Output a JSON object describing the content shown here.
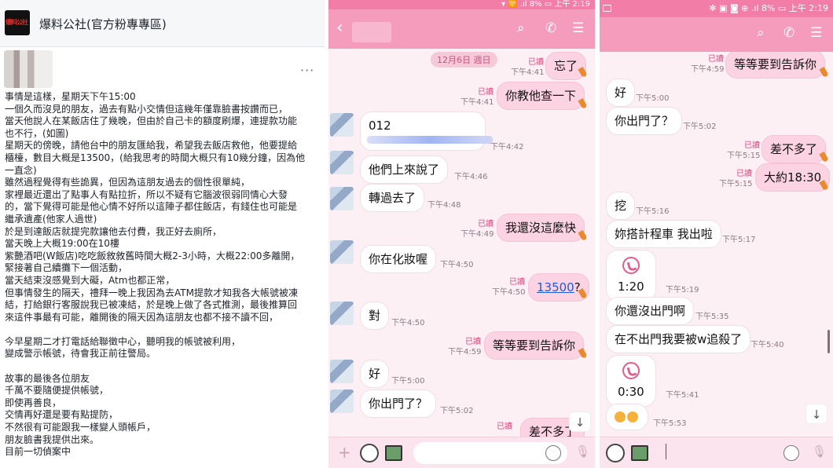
{
  "facebook": {
    "page_name": "爆料公社(官方粉專專區)",
    "logo_text": "爆料公社",
    "more": "···",
    "post_lines": [
      "事情是這樣，星期天下午15:00",
      "一個久而沒見的朋友，過去有點小交情但這幾年僅靠臉書按讚而已，",
      "當天他說人在某飯店住了幾晚，但由於自己卡的額度刷爆，連提款功能",
      "也不行，(如圖)",
      "星期天的傍晚，請他台中的朋友匯給我，希望我去飯店救他，他要提給",
      "櫃檯，數目大概是13500，(給我思考的時間大概只有10幾分鐘，因為他",
      "一直念)",
      "雖然過程覺得有些詭異，但因為這朋友過去的個性很單純，",
      "家裡最近還出了點事人有點拉折，所以不疑有它腦波很弱同情心大發",
      "的，當下覺得可能是他心情不好所以這陣子都住飯店，有錢住也可能是",
      "繼承遺產(他家人過世)",
      "於是到達飯店就提完款讓他去付費，我正好去廁所，",
      "當天晚上大概19:00在10樓",
      "紫艷酒吧(W飯店)吃吃飯敘敘舊時間大概2-3小時，大概22:00多離開，",
      "緊接著自己續攤下一個活動，",
      "當天結束沒感覺到大礙，Atm也都正常，",
      "但事情發生的隔天，禮拜一晚上我因為去ATM提款才知我各大帳號被凍",
      "結，打給銀行客服說我已被凍結，於是晚上做了各式推測，最後推算回",
      "來這件事最有可能，離開後的隔天因為這朋友也都不接不讀不回，",
      "",
      "今早星期二才打電話給聯徵中心，聽明我的帳號被利用，",
      "變成警示帳號，待會我正前往警局。",
      "",
      "故事的最後各位朋友",
      "千萬不要隨便提供帳號，",
      "即使再善良，",
      "交情再好還是要有點提防，",
      "不然很有可能跟我一樣變人頭帳戶，",
      "朋友臉書我提供出來。",
      "目前一切偵案中"
    ]
  },
  "chat1": {
    "status": "▾ 🛜 .ıl 8% ▭ 上午 2:19",
    "icons": {
      "back": "back-arrow-icon",
      "search": "search-icon",
      "call": "phone-icon",
      "menu": "menu-icon"
    },
    "date_label": "12月6日 週日",
    "messages": [
      {
        "dir": "out",
        "text": "忘了",
        "read": "已讀",
        "time": "下午4:41"
      },
      {
        "dir": "out",
        "text": "你教他查一下",
        "read": "已讀",
        "time": "下午4:41"
      },
      {
        "dir": "in",
        "text": "012",
        "time": "下午4:42"
      },
      {
        "dir": "in",
        "text": "他們上來說了",
        "time": "下午4:46"
      },
      {
        "dir": "in",
        "text": "轉過去了",
        "time": "下午4:48"
      },
      {
        "dir": "out",
        "text": "我還沒這麼快",
        "read": "已讀",
        "time": "下午4:49"
      },
      {
        "dir": "in",
        "text": "你在化妝喔",
        "time": "下午4:50"
      },
      {
        "dir": "out",
        "text": "13500",
        "suffix": "?",
        "read": "已讀",
        "time": "下午4:50"
      },
      {
        "dir": "in",
        "text": "對",
        "time": "下午4:50"
      },
      {
        "dir": "out",
        "text": "等等要到告訴你",
        "read": "已讀",
        "time": "下午4:59"
      },
      {
        "dir": "in",
        "text": "好",
        "time": "下午5:00"
      },
      {
        "dir": "in",
        "text": "你出門了？",
        "time": "下午5:02"
      },
      {
        "dir": "out",
        "text": "差不多了",
        "read": "已讀",
        "time": ""
      }
    ],
    "scroll_down": "↓"
  },
  "chat2": {
    "status": "✻ ▣ ◙ ⊕ .ıl 8% ▭ 上午 2:19",
    "icons": {
      "search": "search-icon",
      "call": "phone-icon",
      "menu": "menu-icon"
    },
    "messages": [
      {
        "dir": "out",
        "text": "等等要到告訴你",
        "read": "已讀",
        "time": "下午4:59"
      },
      {
        "dir": "in",
        "text": "好",
        "time": "下午5:00"
      },
      {
        "dir": "in",
        "text": "你出門了？",
        "time": "下午5:02"
      },
      {
        "dir": "out",
        "text": "差不多了",
        "read": "已讀",
        "time": "下午5:15"
      },
      {
        "dir": "out",
        "text": "大約18:30",
        "read": "已讀",
        "time": "下午5:15"
      },
      {
        "dir": "in",
        "text": "挖",
        "time": "下午5:16"
      },
      {
        "dir": "in",
        "text": "妳搭計程車 我出啦",
        "time": "下午5:17"
      },
      {
        "dir": "in",
        "type": "call",
        "text": "1:20",
        "time": "下午5:19"
      },
      {
        "dir": "in",
        "text": "你還沒出門啊",
        "time": "下午5:35"
      },
      {
        "dir": "in",
        "text": "在不出門我要被w追殺了",
        "time": "下午5:40"
      },
      {
        "dir": "in",
        "type": "call",
        "text": "0:30",
        "time": "下午5:41"
      },
      {
        "dir": "in",
        "type": "emoji",
        "text": "",
        "time": "下午5:53"
      }
    ],
    "scroll_down": "↓"
  }
}
